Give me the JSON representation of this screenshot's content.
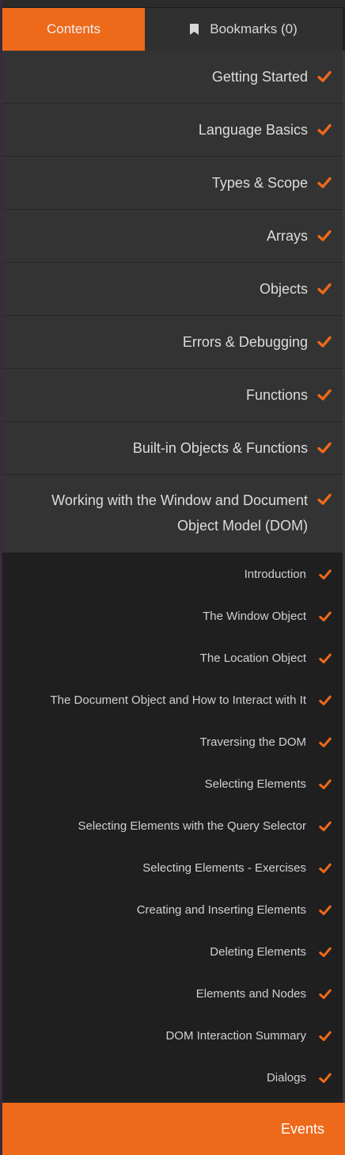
{
  "tabs": {
    "contents_label": "Contents",
    "bookmarks_label": "Bookmarks (0)"
  },
  "sections": [
    {
      "label": "Getting Started",
      "checked": true
    },
    {
      "label": "Language Basics",
      "checked": true
    },
    {
      "label": "Types & Scope",
      "checked": true
    },
    {
      "label": "Arrays",
      "checked": true
    },
    {
      "label": "Objects",
      "checked": true
    },
    {
      "label": "Errors & Debugging",
      "checked": true
    },
    {
      "label": "Functions",
      "checked": true
    },
    {
      "label": "Built-in Objects & Functions",
      "checked": true
    },
    {
      "label": "Working with the Window and Document Object Model (DOM)",
      "checked": true
    }
  ],
  "subitems": [
    {
      "label": "Introduction",
      "checked": true
    },
    {
      "label": "The Window Object",
      "checked": true
    },
    {
      "label": "The Location Object",
      "checked": true
    },
    {
      "label": "The Document Object and How to Interact with It",
      "checked": true
    },
    {
      "label": "Traversing the DOM",
      "checked": true
    },
    {
      "label": "Selecting Elements",
      "checked": true
    },
    {
      "label": "Selecting Elements with the Query Selector",
      "checked": true
    },
    {
      "label": "Selecting Elements - Exercises",
      "checked": true
    },
    {
      "label": "Creating and Inserting Elements",
      "checked": true
    },
    {
      "label": "Deleting Elements",
      "checked": true
    },
    {
      "label": "Elements and Nodes",
      "checked": true
    },
    {
      "label": "DOM Interaction Summary",
      "checked": true
    },
    {
      "label": "Dialogs",
      "checked": true
    }
  ],
  "next_section": {
    "label": "Events"
  },
  "icons": {
    "check": "checkmark-icon",
    "bookmark": "bookmark-icon"
  },
  "colors": {
    "accent": "#ee6a1b",
    "section_bg": "#333333",
    "subitem_bg": "#1f1f1f",
    "text": "#dcdcdc"
  }
}
